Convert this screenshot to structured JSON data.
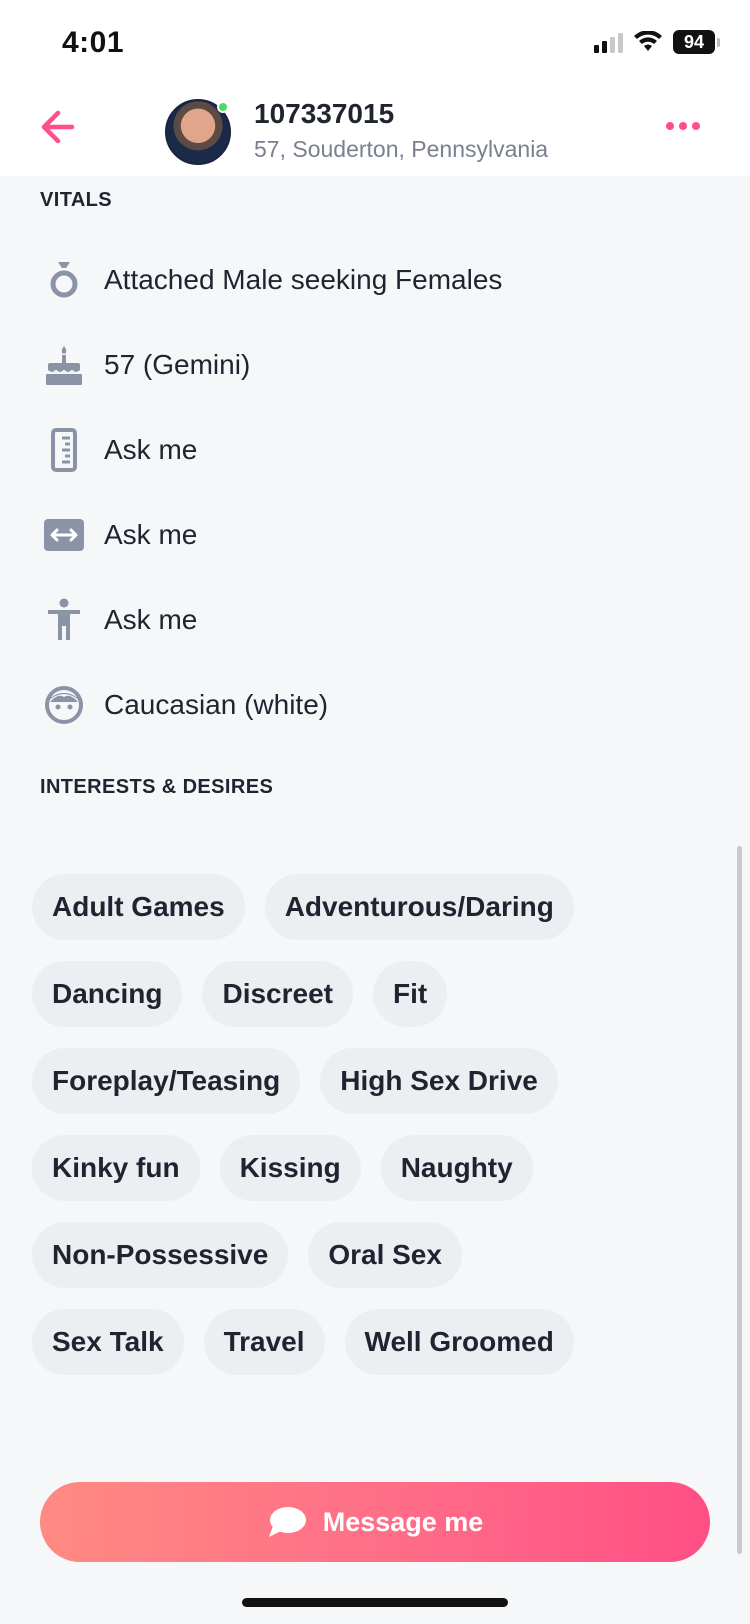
{
  "status_bar": {
    "time": "4:01",
    "battery": "94"
  },
  "header": {
    "profile_id": "107337015",
    "location": "57, Souderton, Pennsylvania",
    "online": true
  },
  "vitals": {
    "title": "VITALS",
    "items": [
      {
        "icon": "ring-icon",
        "text": "Attached Male seeking Females"
      },
      {
        "icon": "birthday-cake-icon",
        "text": "57 (Gemini)"
      },
      {
        "icon": "ruler-icon",
        "text": "Ask me"
      },
      {
        "icon": "width-icon",
        "text": "Ask me"
      },
      {
        "icon": "body-type-icon",
        "text": "Ask me"
      },
      {
        "icon": "face-icon",
        "text": "Caucasian (white)"
      }
    ]
  },
  "interests": {
    "title": "INTERESTS & DESIRES",
    "tags": [
      [
        "Adult Games",
        "Adventurous/Daring"
      ],
      [
        "Dancing",
        "Discreet",
        "Fit"
      ],
      [
        "Foreplay/Teasing",
        "High Sex Drive"
      ],
      [
        "Kinky fun",
        "Kissing",
        "Naughty"
      ],
      [
        "Non-Possessive",
        "Oral Sex"
      ],
      [
        "Sex Talk",
        "Travel",
        "Well Groomed"
      ]
    ]
  },
  "actions": {
    "message_label": "Message me"
  },
  "colors": {
    "accent": "#ff4f86",
    "icon_gray": "#8a94a6",
    "tag_bg": "#eceef2"
  }
}
